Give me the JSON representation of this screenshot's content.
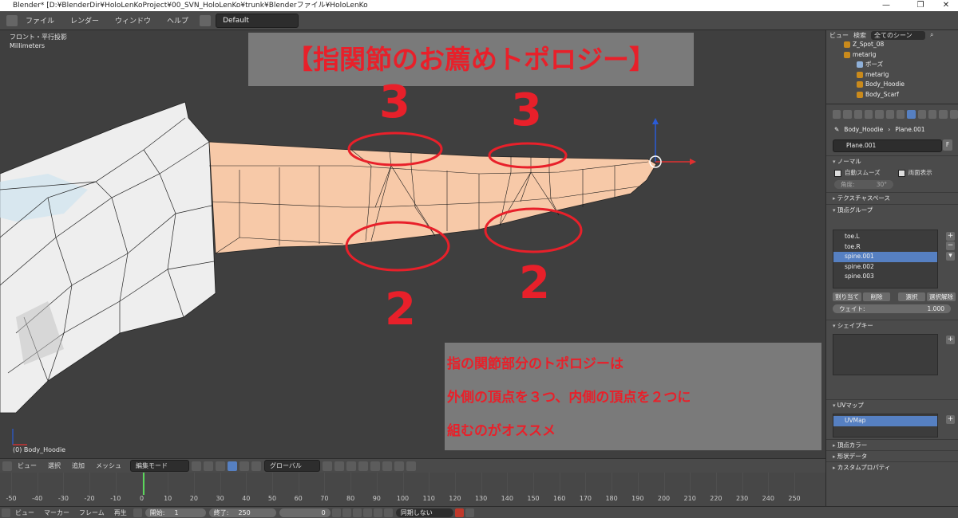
{
  "titlebar": {
    "text": "Blender* [D:¥BlenderDir¥HoloLenKoProject¥00_SVN_HoloLenKo¥trunk¥Blenderファイル¥HoloLenKo",
    "minimize": "—",
    "maximize": "❐",
    "close": "✕"
  },
  "menu": {
    "file": "ファイル",
    "render": "レンダー",
    "window": "ウィンドウ",
    "help": "ヘルプ",
    "layout": "Default"
  },
  "banner": {
    "title": "【指関節のお薦めトポロジー】"
  },
  "viewport": {
    "view_name": "フロント・平行投影",
    "units": "Millimeters",
    "object_info": "(0) Body_Hoodie"
  },
  "annotations": {
    "top_left": "3",
    "top_right": "3",
    "bottom_left": "2",
    "bottom_right": "2"
  },
  "note": {
    "line1": "指の関節部分のトポロジーは",
    "line2": "外側の頂点を３つ、内側の頂点を２つに",
    "line3": "組むのがオススメ"
  },
  "view_header": {
    "view": "ビュー",
    "select": "選択",
    "add": "追加",
    "mesh": "メッシュ",
    "mode": "編集モード",
    "orientation": "グローバル"
  },
  "timeline": {
    "ticks": [
      "-50",
      "-40",
      "-30",
      "-20",
      "-10",
      "0",
      "10",
      "20",
      "30",
      "40",
      "50",
      "60",
      "70",
      "80",
      "90",
      "100",
      "110",
      "120",
      "130",
      "140",
      "150",
      "160",
      "170",
      "180",
      "190",
      "200",
      "210",
      "220",
      "230",
      "240",
      "250"
    ]
  },
  "tl_bar": {
    "view": "ビュー",
    "marker": "マーカー",
    "frame": "フレーム",
    "playback": "再生",
    "start_label": "開始:",
    "start_value": "1",
    "end_label": "終了:",
    "end_value": "250",
    "current": "0",
    "sync": "同期しない"
  },
  "outliner": {
    "view": "ビュー",
    "search": "検索",
    "scene_filter": "全てのシーン",
    "items": [
      "Z_Spot_08",
      "metarig",
      "ポーズ",
      "metarig",
      "Body_Hoodie",
      "Body_Scarf"
    ]
  },
  "properties": {
    "crumb_object": "Body_Hoodie",
    "crumb_mesh": "Plane.001",
    "mesh_name": "Plane.001",
    "fake_user": "F",
    "normals_header": "ノーマル",
    "auto_smooth": "自動スムーズ",
    "double_sided": "両面表示",
    "angle_label": "角度:",
    "angle_value": "30°",
    "texture_space": "テクスチャスペース",
    "vertex_groups": "頂点グループ",
    "vg_items": [
      "toe.L",
      "toe.R",
      "spine.001",
      "spine.002",
      "spine.003"
    ],
    "vg_selected_index": 2,
    "assign": "割り当て",
    "remove": "削除",
    "select": "選択",
    "deselect": "選択解除",
    "weight_label": "ウェイト:",
    "weight_value": "1.000",
    "shape_keys": "シェイプキー",
    "uv_maps": "UVマップ",
    "uv_item": "UVMap",
    "vertex_colors": "頂点カラー",
    "geometry_data": "形状データ",
    "custom_props": "カスタムプロパティ"
  },
  "colors": {
    "accent_red": "#e8202a",
    "selection_blue": "#5680c2",
    "mesh_skin": "#f7c9a8",
    "frame_cursor": "#5bd65b"
  }
}
